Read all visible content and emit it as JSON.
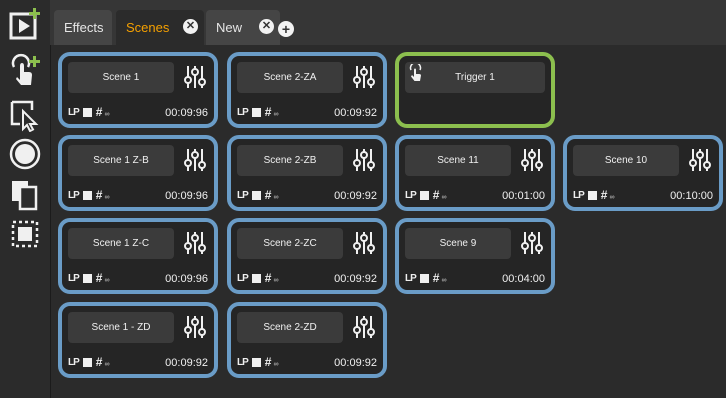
{
  "toolbar": {
    "tools": [
      {
        "name": "add-scene-tool",
        "icon": "play-add-icon"
      },
      {
        "name": "add-trigger-tool",
        "icon": "touch-add-icon"
      },
      {
        "name": "select-tool",
        "icon": "select-cursor-icon"
      },
      {
        "name": "record-tool",
        "icon": "record-icon"
      },
      {
        "name": "duplicate-tool",
        "icon": "duplicate-icon"
      },
      {
        "name": "group-tool",
        "icon": "dashed-select-icon"
      }
    ]
  },
  "tabs": [
    {
      "label": "Effects",
      "closable": false,
      "active": false
    },
    {
      "label": "Scenes",
      "closable": true,
      "active": true
    },
    {
      "label": "New",
      "closable": true,
      "active": false
    }
  ],
  "tab_close_glyph": "✕",
  "add_tab_glyph": "+",
  "scene_tag": {
    "lp": "LP",
    "hash": "#",
    "inf": "∞"
  },
  "cards": [
    {
      "type": "scene",
      "name": "Scene 1",
      "duration": "00:09:96"
    },
    {
      "type": "scene",
      "name": "Scene 2-ZA",
      "duration": "00:09:92"
    },
    {
      "type": "trigger",
      "name": "Trigger 1"
    },
    {
      "type": "scene",
      "name": "Scene 1 Z-B",
      "duration": "00:09:96"
    },
    {
      "type": "scene",
      "name": "Scene 2-ZB",
      "duration": "00:09:92"
    },
    {
      "type": "scene",
      "name": "Scene 11",
      "duration": "00:01:00"
    },
    {
      "type": "scene",
      "name": "Scene 10",
      "duration": "00:10:00"
    },
    {
      "type": "scene",
      "name": "Scene 1 Z-C",
      "duration": "00:09:96"
    },
    {
      "type": "scene",
      "name": "Scene 2-ZC",
      "duration": "00:09:92"
    },
    {
      "type": "scene",
      "name": "Scene 9",
      "duration": "00:04:00"
    },
    {
      "type": "scene",
      "name": "Scene 1 - ZD",
      "duration": "00:09:92"
    },
    {
      "type": "scene",
      "name": "Scene 2-ZD",
      "duration": "00:09:92"
    }
  ],
  "colors": {
    "scene_border": "#6a9cc7",
    "trigger_border": "#8cbf4e",
    "active_tab": "#f5a000",
    "add_accent": "#8cbf4e"
  }
}
